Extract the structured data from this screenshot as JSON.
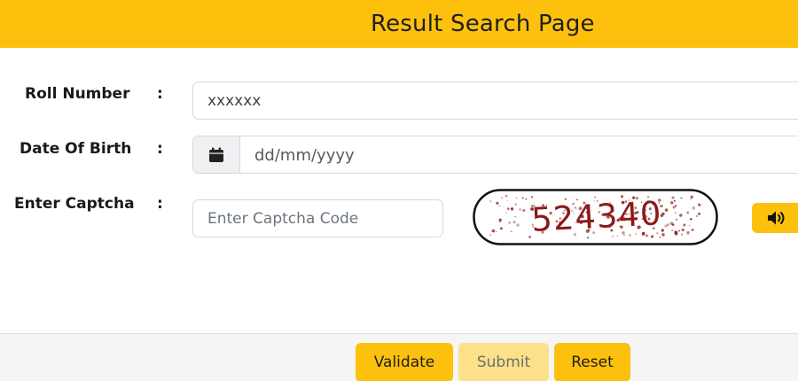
{
  "header": {
    "title": "Result Search Page"
  },
  "form": {
    "roll_number": {
      "label": "Roll Number",
      "colon": ":",
      "value": "xxxxxx"
    },
    "date_of_birth": {
      "label": "Date Of Birth",
      "colon": ":",
      "placeholder": "dd/mm/yyyy",
      "icon": "calendar-icon"
    },
    "captcha": {
      "label": "Enter Captcha",
      "colon": ":",
      "placeholder": "Enter Captcha Code",
      "code": "524340",
      "audio_icon": "speaker-icon"
    }
  },
  "footer": {
    "validate_label": "Validate",
    "submit_label": "Submit",
    "reset_label": "Reset"
  },
  "colors": {
    "accent": "#fdc10d",
    "accent_disabled": "#fde08a",
    "captcha_text": "#8b1a1a"
  }
}
